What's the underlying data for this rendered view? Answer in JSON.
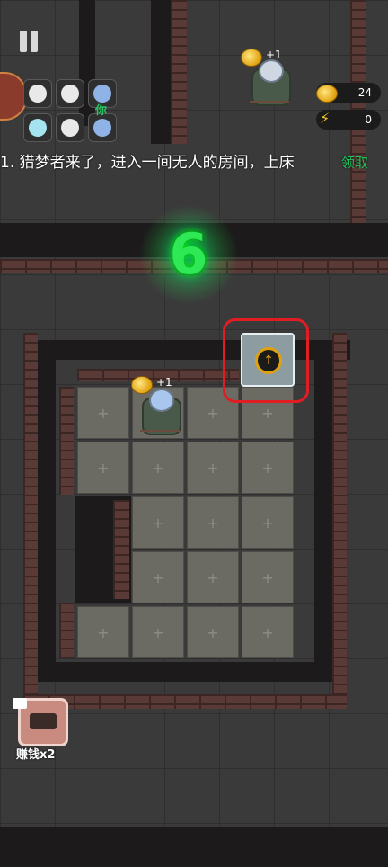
{
  "hud": {
    "coins": "24",
    "energy": "0",
    "coin_icon": "coin-icon",
    "energy_icon": "lightning-icon"
  },
  "players": {
    "you_label": "你"
  },
  "task": {
    "text": "1. 猎梦者来了，进入一间无人的房间，上床",
    "claim": "领取"
  },
  "countdown": "6",
  "bonuses": {
    "top_bed_plus": "+1",
    "room_bed_plus": "+1"
  },
  "earn": {
    "label": "赚钱x2"
  }
}
